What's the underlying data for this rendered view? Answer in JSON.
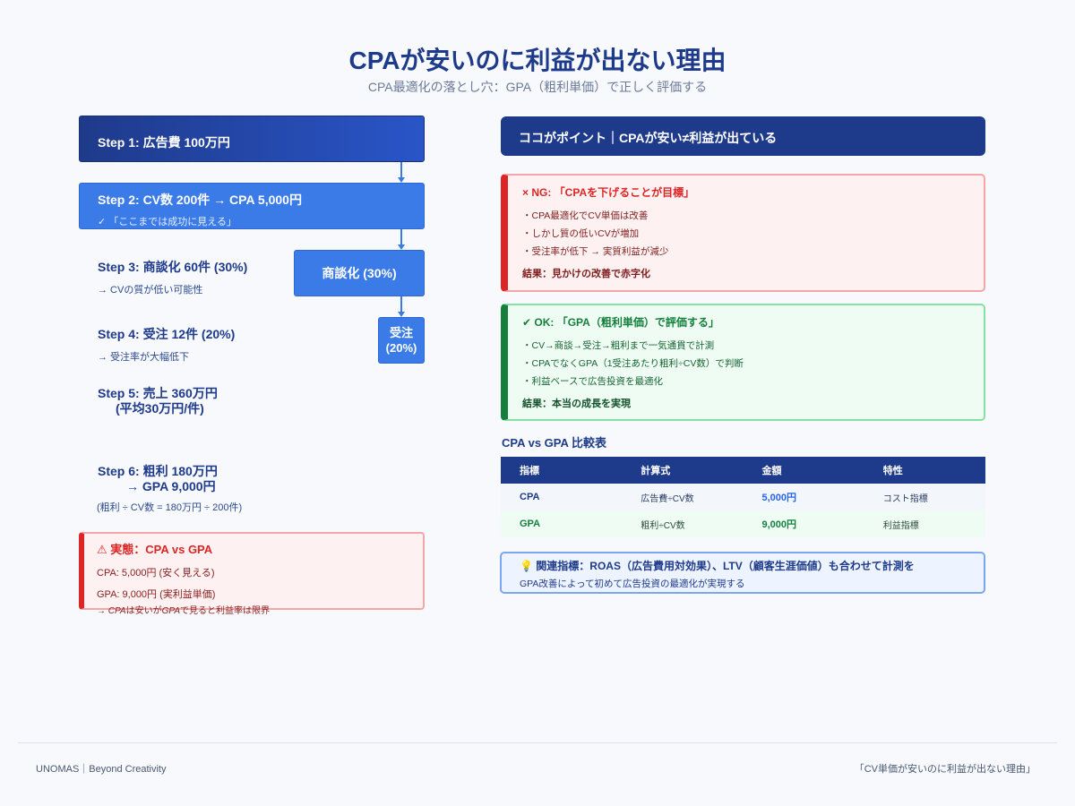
{
  "header": {
    "title": "CPAが安いのに利益が出ない理由",
    "subtitle": "CPA最適化の落とし穴：GPA（粗利単価）で正しく評価する"
  },
  "funnel": {
    "step1": "Step 1: 広告費 100万円",
    "step2": "Step 2: CV数 200件 → CPA 5,000円",
    "step2_note": "✓ 「ここまでは成功に見える」",
    "shodan_box": "商談化 (30%)",
    "juchu_box_1": "受注",
    "juchu_box_2": "(20%)",
    "step3": "Step 3: 商談化 60件 (30%)",
    "step3_note": "→ CVの質が低い可能性",
    "step4": "Step 4: 受注 12件 (20%)",
    "step4_note": "→ 受注率が大幅低下",
    "step5_1": "Step 5: 売上 360万円",
    "step5_2": "(平均30万円/件)",
    "step6_1": "Step 6: 粗利 180万円",
    "step6_2": "→ GPA 9,000円",
    "step6_note": "(粗利 ÷ CV数 = 180万円 ÷ 200件)"
  },
  "reality": {
    "heading": "⚠ 実態：CPA vs GPA",
    "cpa_line": "CPA: 5,000円 (安く見える)",
    "gpa_line": "GPA: 9,000円 (実利益単価)",
    "note_prefix": "→ ",
    "note_cpa": "CPA",
    "note_mid": "は安いが",
    "note_gpa": "GPA",
    "note_suffix": "で見ると利益率は限界"
  },
  "point_bar": "ココがポイント｜CPAが安い≠利益が出ている",
  "ng_card": {
    "heading": "× NG: 「CPAを下げることが目標」",
    "items": [
      "・CPA最適化でCV単価は改善",
      "・しかし質の低いCVが増加",
      "・受注率が低下 → 実質利益が減少"
    ],
    "result": "結果：見かけの改善で赤字化"
  },
  "ok_card": {
    "heading": "✔ OK: 「GPA（粗利単価）で評価する」",
    "items": [
      "・CV→商談→受注→粗利まで一気通貫で計測",
      "・CPAでなくGPA（1受注あたり粗利÷CV数）で判断",
      "・利益ベースで広告投資を最適化"
    ],
    "result": "結果：本当の成長を実現"
  },
  "table": {
    "title": "CPA vs GPA 比較表",
    "headers": [
      "指標",
      "計算式",
      "金額",
      "特性"
    ],
    "rows": [
      [
        "CPA",
        "広告費÷CV数",
        "5,000円",
        "コスト指標"
      ],
      [
        "GPA",
        "粗利÷CV数",
        "9,000円",
        "利益指標"
      ]
    ]
  },
  "related": {
    "heading": "💡 関連指標：ROAS（広告費用対効果）、LTV（顧客生涯価値）も合わせて計測を",
    "text": "GPA改善によって初めて広告投資の最適化が実現する"
  },
  "footer": {
    "left": "UNOMAS｜Beyond Creativity",
    "right": "「CV単価が安いのに利益が出ない理由」"
  },
  "colors": {
    "navy": "#1e3a8a",
    "blue": "#3b7be8",
    "red": "#dc2626",
    "green": "#15803d"
  }
}
